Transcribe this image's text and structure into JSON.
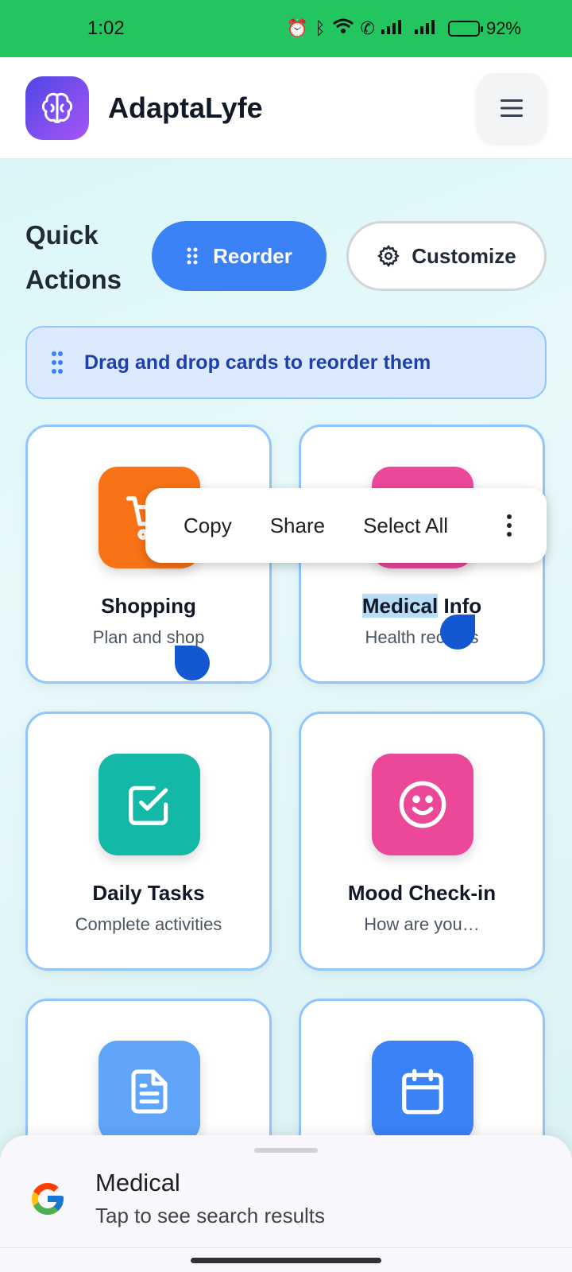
{
  "status_bar": {
    "time": "1:02",
    "battery": "92%"
  },
  "header": {
    "app_name": "AdaptaLyfe"
  },
  "quick_actions": {
    "title": "Quick Actions",
    "reorder_label": "Reorder",
    "customize_label": "Customize",
    "hint": "Drag and drop cards to reorder them"
  },
  "cards": [
    {
      "title": "Shopping",
      "subtitle": "Plan and shop",
      "icon": "cart-icon",
      "color": "#f97316"
    },
    {
      "title_highlight": "Medical",
      "title_rest": " Info",
      "subtitle": "Health records",
      "icon": "medical-icon",
      "color": "#ec4899"
    },
    {
      "title": "Daily Tasks",
      "subtitle": "Complete activities",
      "icon": "checkbox-icon",
      "color": "#14b8a6"
    },
    {
      "title": "Mood Check-in",
      "subtitle": "How are you…",
      "icon": "smile-icon",
      "color": "#ec4899"
    },
    {
      "title": "",
      "subtitle": "",
      "icon": "document-icon",
      "color": "#60a5fa"
    },
    {
      "title": "",
      "subtitle": "",
      "icon": "calendar-icon",
      "color": "#3b82f6"
    }
  ],
  "context_menu": {
    "copy": "Copy",
    "share": "Share",
    "select_all": "Select All"
  },
  "search_sheet": {
    "query": "Medical",
    "subtitle": "Tap to see search results"
  }
}
